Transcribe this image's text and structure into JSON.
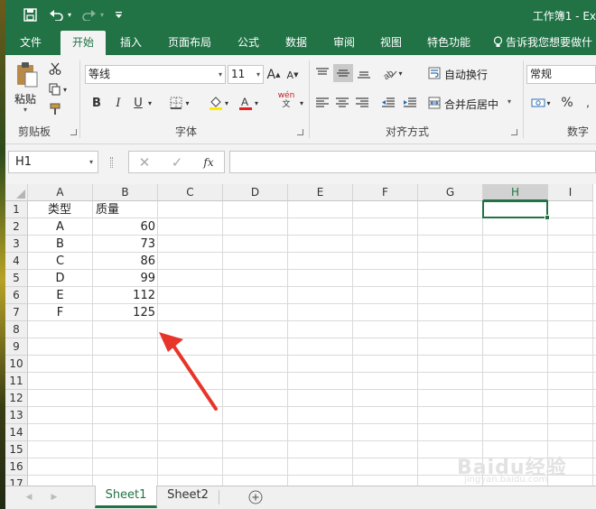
{
  "window": {
    "title": "工作簿1 - Ex"
  },
  "quick_access": {
    "save": "save-icon",
    "undo": "undo-icon",
    "redo": "redo-icon",
    "customize": "customize-icon"
  },
  "tabs": [
    {
      "label": "文件"
    },
    {
      "label": "开始"
    },
    {
      "label": "插入"
    },
    {
      "label": "页面布局"
    },
    {
      "label": "公式"
    },
    {
      "label": "数据"
    },
    {
      "label": "审阅"
    },
    {
      "label": "视图"
    },
    {
      "label": "特色功能"
    }
  ],
  "tell_me": "告诉我您想要做什",
  "ribbon": {
    "clipboard": {
      "paste": "粘贴",
      "group": "剪贴板"
    },
    "font": {
      "name": "等线",
      "size": "11",
      "bold": "B",
      "italic": "I",
      "underline": "U",
      "grow": "A",
      "shrink": "A",
      "phonetic": "wén",
      "group": "字体"
    },
    "alignment": {
      "wrap": "自动换行",
      "merge": "合并后居中",
      "group": "对齐方式"
    },
    "number": {
      "format": "常规",
      "percent": "%",
      "group": "数字"
    }
  },
  "formula_bar": {
    "name_box": "H1",
    "fx": "fx",
    "value": ""
  },
  "columns": [
    "A",
    "B",
    "C",
    "D",
    "E",
    "F",
    "G",
    "H",
    "I"
  ],
  "rows": [
    "1",
    "2",
    "3",
    "4",
    "5",
    "6",
    "7",
    "8",
    "9",
    "10",
    "11",
    "12",
    "13",
    "14",
    "15",
    "16",
    "17"
  ],
  "cells": {
    "A1": "类型",
    "B1": "质量",
    "A2": "A",
    "B2": "60",
    "A3": "B",
    "B3": "73",
    "A4": "C",
    "B4": "86",
    "A5": "D",
    "B5": "99",
    "A6": "E",
    "B6": "112",
    "A7": "F",
    "B7": "125"
  },
  "selected_cell": "H1",
  "sheets": [
    {
      "label": "Sheet1"
    },
    {
      "label": "Sheet2"
    }
  ],
  "active_sheet": "Sheet1",
  "colors": {
    "accent": "#217346",
    "arrow": "#e8352a"
  }
}
